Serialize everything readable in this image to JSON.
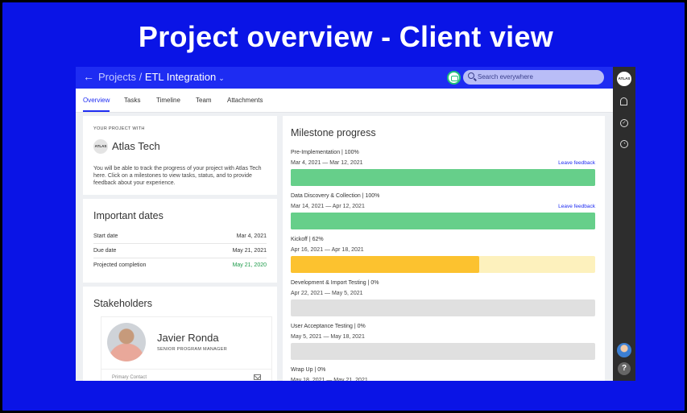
{
  "slide": {
    "title": "Project overview - Client view"
  },
  "header": {
    "back_glyph": "←",
    "breadcrumb_parent": "Projects",
    "breadcrumb_sep": " / ",
    "breadcrumb_current": "ETL Integration",
    "dropdown_glyph": "⌄",
    "search_placeholder": "Search everywhere"
  },
  "tabs": [
    {
      "label": "Overview",
      "active": true
    },
    {
      "label": "Tasks"
    },
    {
      "label": "Timeline"
    },
    {
      "label": "Team"
    },
    {
      "label": "Attachments"
    }
  ],
  "rail": {
    "logo_text": "ATLAS",
    "help_glyph": "?"
  },
  "client_card": {
    "eyebrow": "YOUR PROJECT WITH",
    "logo_text": "ATLAS",
    "company_name": "Atlas Tech",
    "description": "You will be able to track the progress of your project with Atlas Tech here. Click on a milestones to view tasks, status, and to provide feedback about your experience."
  },
  "important_dates": {
    "heading": "Important dates",
    "rows": [
      {
        "label": "Start date",
        "value": "Mar 4, 2021"
      },
      {
        "label": "Due date",
        "value": "May 21, 2021"
      },
      {
        "label": "Projected completion",
        "value": "May 21, 2020",
        "color": "#1d9b4a"
      }
    ]
  },
  "stakeholders": {
    "heading": "Stakeholders",
    "person": {
      "name": "Javier Ronda",
      "role": "SENIOR PROGRAM MANAGER",
      "contact_label": "Primary Contact"
    }
  },
  "milestones": {
    "heading": "Milestone progress",
    "feedback_label": "Leave feedback",
    "items": [
      {
        "name": "Pre-Implementation | 100%",
        "dates": "Mar 4, 2021 — Mar 12, 2021",
        "progress": 100,
        "feedback": true,
        "fill_color": "#66cf8a",
        "track_color": "#66cf8a"
      },
      {
        "name": "Data Discovery & Collection | 100%",
        "dates": "Mar 14, 2021 — Apr 12, 2021",
        "progress": 100,
        "feedback": true,
        "fill_color": "#66cf8a",
        "track_color": "#66cf8a"
      },
      {
        "name": "Kickoff | 62%",
        "dates": "Apr 16, 2021 — Apr 18, 2021",
        "progress": 62,
        "feedback": false,
        "fill_color": "#fcc22f",
        "track_color": "#fdf1bd"
      },
      {
        "name": "Development & Import Testing | 0%",
        "dates": "Apr 22, 2021 — May 5, 2021",
        "progress": 0,
        "feedback": false,
        "fill_color": "#e0e0e0",
        "track_color": "#e0e0e0"
      },
      {
        "name": "User Acceptance Testing | 0%",
        "dates": "May 5, 2021 — May 18, 2021",
        "progress": 0,
        "feedback": false,
        "fill_color": "#e0e0e0",
        "track_color": "#e0e0e0"
      },
      {
        "name": "Wrap Up | 0%",
        "dates": "May 18, 2021 — May 21, 2021",
        "progress": 0,
        "feedback": false,
        "fill_color": "#e0e0e0",
        "track_color": "#e0e0e0"
      }
    ]
  }
}
